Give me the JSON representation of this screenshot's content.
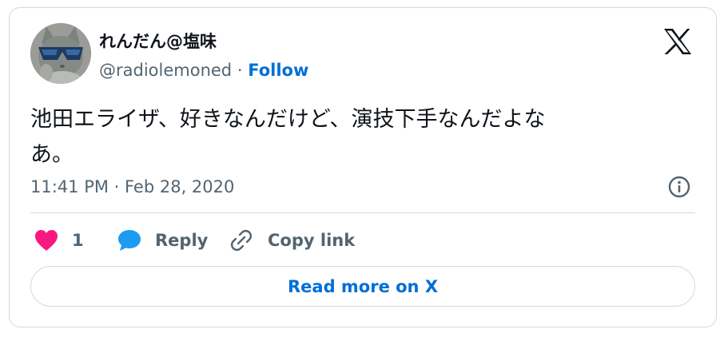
{
  "author": {
    "display_name": "れんだん@塩味",
    "handle": "@radiolemoned",
    "separator": "·",
    "follow_label": "Follow"
  },
  "tweet": {
    "text_line1": "池田エライザ、好きなんだけど、演技下手なんだよな",
    "text_line2": "あ。",
    "timestamp": "11:41 PM · Feb 28, 2020"
  },
  "actions": {
    "like_count": "1",
    "reply_label": "Reply",
    "copy_link_label": "Copy link"
  },
  "read_more_label": "Read more on X",
  "icons": {
    "brand": "x-logo-icon",
    "info": "info-icon",
    "like": "heart-icon",
    "reply": "speech-bubble-icon",
    "copy": "link-icon"
  },
  "colors": {
    "link": "#006fd6",
    "like": "#f91880",
    "reply": "#1d9bf0",
    "muted": "#536471",
    "border": "#cfd9de"
  }
}
